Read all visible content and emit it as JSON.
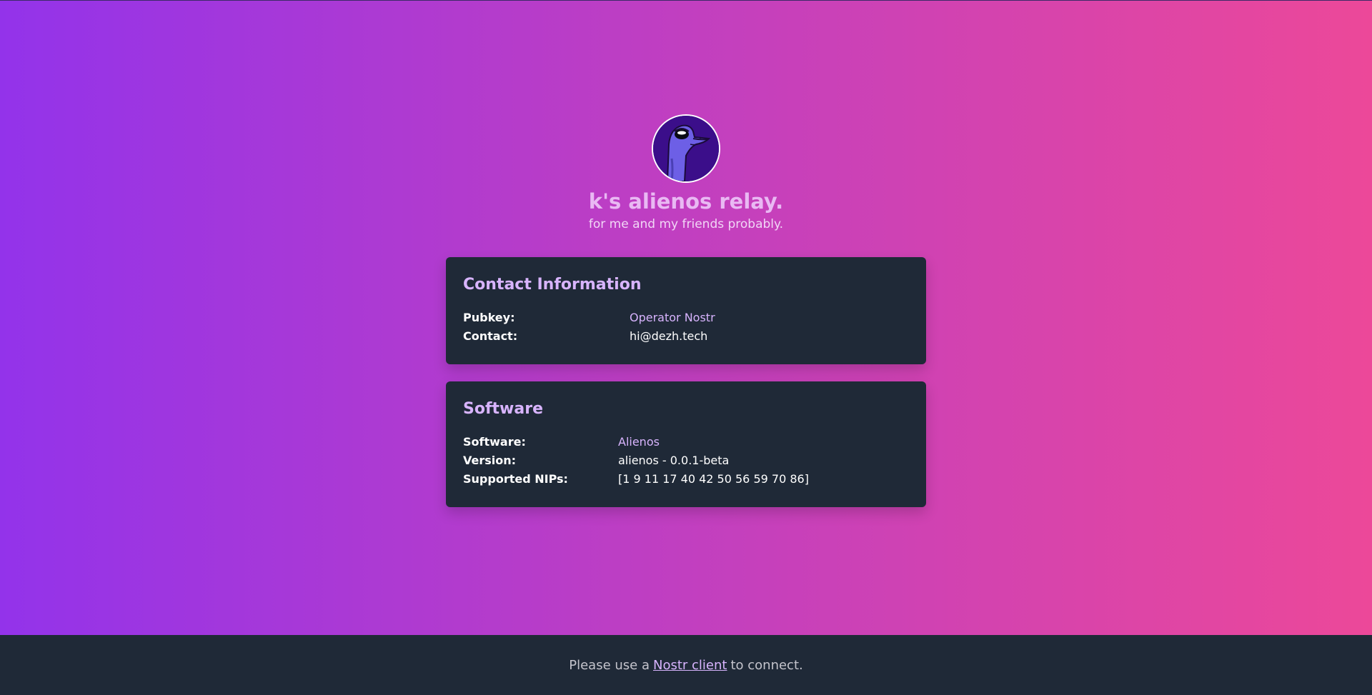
{
  "header": {
    "avatar_icon": "ostrich-avatar-icon",
    "title": "k's alienos relay.",
    "subtitle": "for me and my friends probably."
  },
  "contact": {
    "heading": "Contact Information",
    "rows": [
      {
        "label": "Pubkey:",
        "value": "Operator Nostr"
      },
      {
        "label": "Contact:",
        "value": "hi@dezh.tech"
      }
    ]
  },
  "software": {
    "heading": "Software",
    "rows": [
      {
        "label": "Software:",
        "value": "Alienos"
      },
      {
        "label": "Version:",
        "value": "alienos - 0.0.1-beta"
      },
      {
        "label": "Supported NIPs:",
        "value": "[1 9 11 17 40 42 50 56 59 70 86]"
      }
    ]
  },
  "footer": {
    "prefix": "Please use a",
    "link": "Nostr client",
    "suffix": "to connect."
  },
  "colors": {
    "gradient_start": "#9333ea",
    "gradient_end": "#ec4899",
    "card_bg": "#1f2937",
    "accent": "#d8b4fe"
  }
}
